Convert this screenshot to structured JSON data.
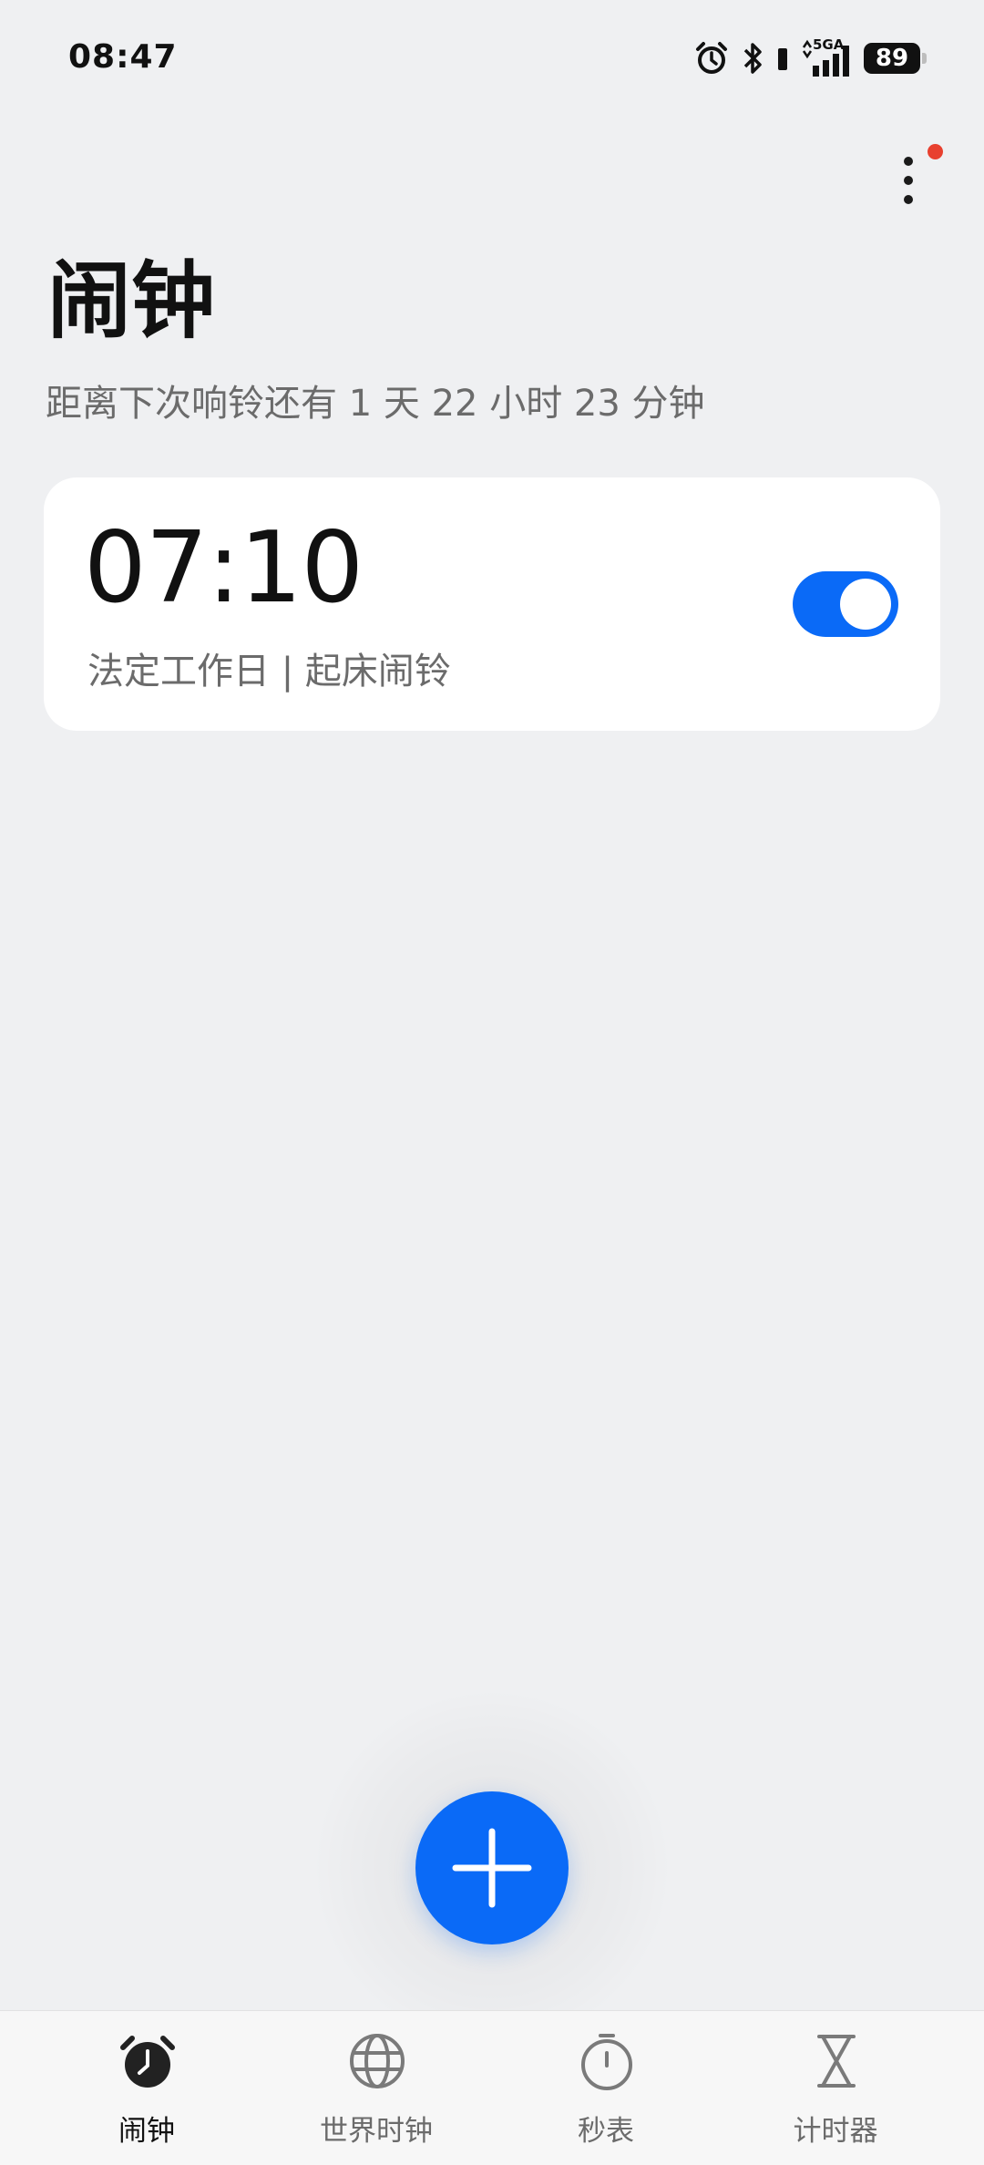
{
  "status_bar": {
    "time": "08:47",
    "network_label": "5GA",
    "battery": "89",
    "icons": [
      "alarm-icon",
      "bluetooth-icon",
      "signal-icon",
      "battery-icon"
    ]
  },
  "header": {
    "title": "闹钟",
    "subtitle": "距离下次响铃还有 1 天 22 小时 23 分钟"
  },
  "alarms": [
    {
      "time": "07:10",
      "description": "法定工作日 | 起床闹铃",
      "enabled": true
    }
  ],
  "fab": {
    "icon": "plus-icon"
  },
  "bottom_nav": {
    "items": [
      {
        "label": "闹钟",
        "icon": "alarm-clock-icon",
        "active": true
      },
      {
        "label": "世界时钟",
        "icon": "globe-icon",
        "active": false
      },
      {
        "label": "秒表",
        "icon": "stopwatch-icon",
        "active": false
      },
      {
        "label": "计时器",
        "icon": "hourglass-icon",
        "active": false
      }
    ]
  },
  "colors": {
    "accent": "#0a6af7",
    "background": "#eff0f2",
    "notification_dot": "#e8402f"
  }
}
